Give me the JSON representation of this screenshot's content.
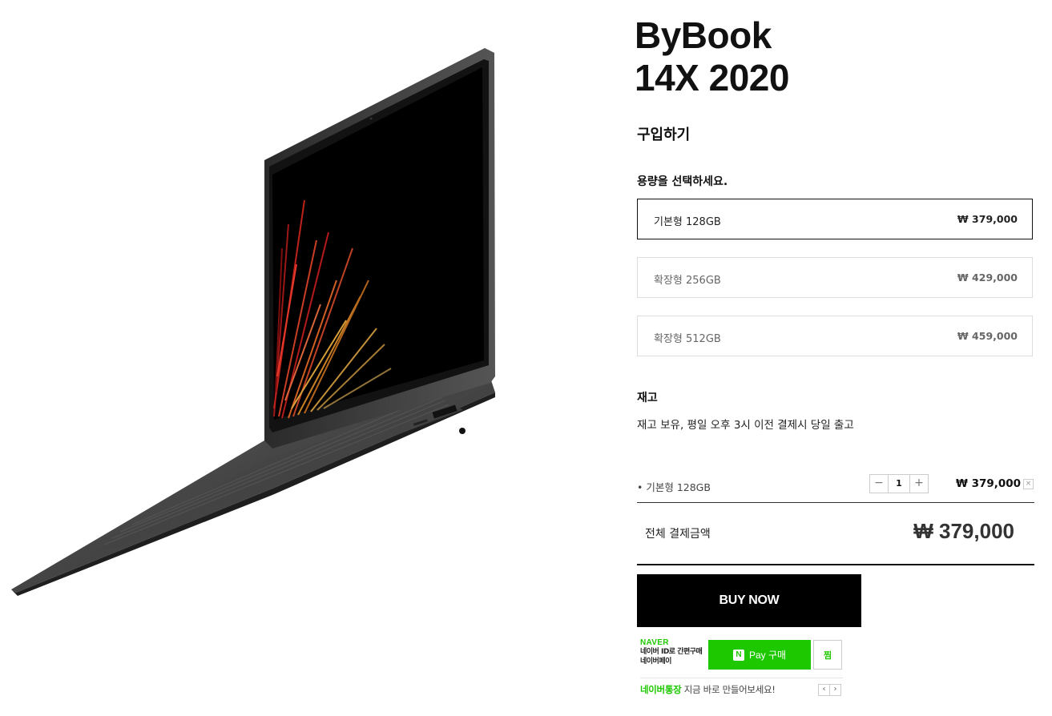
{
  "product": {
    "title_line1": "ByBook",
    "title_line2": "14X 2020",
    "image_alt": "ByBook 14X 2020 laptop"
  },
  "purchase": {
    "heading": "구입하기",
    "select_prompt": "용량을 선택하세요.",
    "options": [
      {
        "name": "기본형 128GB",
        "price": "₩ 379,000",
        "selected": true
      },
      {
        "name": "확장형 256GB",
        "price": "₩ 429,000",
        "selected": false
      },
      {
        "name": "확장형 512GB",
        "price": "₩ 459,000",
        "selected": false
      }
    ]
  },
  "stock": {
    "heading": "재고",
    "text": "재고 보유, 평일 오후 3시 이전 결제시 당일 출고"
  },
  "selected_item": {
    "name": "• 기본형 128GB",
    "quantity": "1",
    "minus": "−",
    "plus": "+",
    "price": "₩ 379,000",
    "remove": "×"
  },
  "total": {
    "label": "전체 결제금액",
    "value": "₩  379,000"
  },
  "buttons": {
    "buy_now": "BUY NOW",
    "npay_label": "Pay 구매",
    "npay_n": "N",
    "zzim": "찜"
  },
  "naver": {
    "logo": "NAVER",
    "sub_line1": "네이버 ID로 간편구매",
    "sub_line2": "네이버페이",
    "bank_highlight": "네이버통장",
    "bank_text": " 지금 바로 만들어보세요!",
    "prev": "‹",
    "next": "›"
  },
  "colors": {
    "naver_green": "#1ec800",
    "buy_button": "#000000",
    "selected_border": "#111111"
  }
}
